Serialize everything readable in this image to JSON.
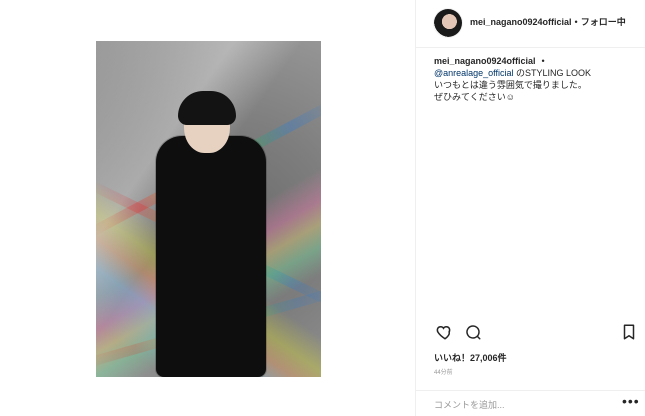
{
  "header": {
    "username": "mei_nagano0924official",
    "follow_separator": "•",
    "follow_label": "フォロー中"
  },
  "caption": {
    "username": "mei_nagano0924official",
    "bullet": "•",
    "mention": "@anrealage_official",
    "after_mention": " のSTYLING LOOK",
    "line2": "いつもとは違う雰囲気で撮りました。",
    "line3": "ぜひみてください☺"
  },
  "post": {
    "likes_label": "いいね！27,006件",
    "time_ago": "44分前"
  },
  "comment": {
    "placeholder": "コメントを追加...",
    "more": "•••"
  },
  "icons": {
    "heart": "heart-icon",
    "comment": "comment-icon",
    "bookmark": "bookmark-icon",
    "more": "more-icon"
  },
  "colors": {
    "text": "#262626",
    "muted": "#999999",
    "mention": "#003569",
    "divider": "#efefef"
  }
}
